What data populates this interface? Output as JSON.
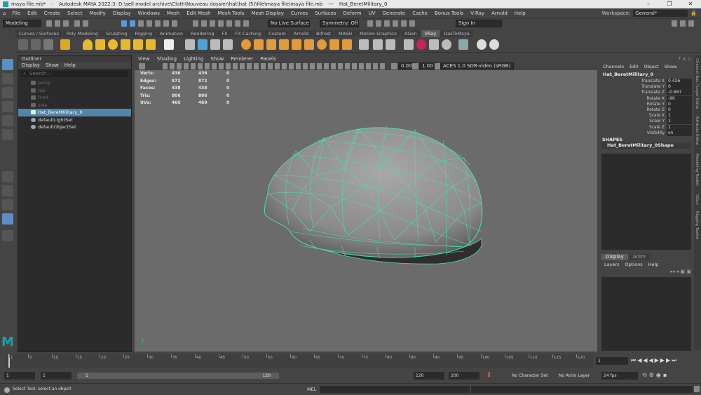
{
  "window": {
    "file": "maya file.mb*",
    "sep1": "-",
    "app": "Autodesk MAYA 2022.3: D:\\sell model archive\\Cloth\\Nouveau dossier\\hat\\hat (5)\\file\\maya file\\maya file.mb",
    "sep2": "---",
    "object": "Hat_BeretMilitary_0",
    "controls": [
      "–",
      "❐",
      "✕"
    ]
  },
  "menubar": {
    "items": [
      "File",
      "Edit",
      "Create",
      "Select",
      "Modify",
      "Display",
      "Windows",
      "Mesh",
      "Edit Mesh",
      "Mesh Tools",
      "Mesh Display",
      "Curves",
      "Surfaces",
      "Deform",
      "UV",
      "Generate",
      "Cache",
      "Bonus Tools",
      "V-Ray",
      "Arnold",
      "Help"
    ],
    "workspace_label": "Workspace:",
    "workspace_value": "General*"
  },
  "statusline": {
    "mode": "Modeling",
    "live_surface": "No Live Surface",
    "symmetry": "Symmetry: Off",
    "sign_in": "Sign In"
  },
  "shelf": {
    "tabs": [
      "Curves / Surfaces",
      "Poly Modeling",
      "Sculpting",
      "Rigging",
      "Animation",
      "Rendering",
      "FX",
      "FX Caching",
      "Custom",
      "Arnold",
      "Bifrost",
      "MASH",
      "Motion Graphics",
      "XGen",
      "VRay",
      "DasToMaya"
    ],
    "active_tab": "VRay"
  },
  "outliner": {
    "title": "Outliner",
    "menu": [
      "Display",
      "Show",
      "Help"
    ],
    "search_placeholder": "Search...",
    "items": [
      {
        "label": "persp",
        "state": "dim"
      },
      {
        "label": "top",
        "state": "dim"
      },
      {
        "label": "front",
        "state": "dim"
      },
      {
        "label": "side",
        "state": "dim"
      },
      {
        "label": "Hat_BeretMilitary_0",
        "state": "selected"
      },
      {
        "label": "defaultLightSet",
        "state": "normal"
      },
      {
        "label": "defaultObjectSet",
        "state": "normal"
      }
    ]
  },
  "viewport": {
    "menu": [
      "View",
      "Shading",
      "Lighting",
      "Show",
      "Renderer",
      "Panels"
    ],
    "toolbar": {
      "exposure": "0.00",
      "gamma": "1.00",
      "color_space": "ACES 1.0 SDR-video (sRGB)"
    },
    "hud": [
      {
        "label": "Verts:",
        "v1": "436",
        "v2": "436",
        "v3": "0"
      },
      {
        "label": "Edges:",
        "v1": "872",
        "v2": "872",
        "v3": "0"
      },
      {
        "label": "Faces:",
        "v1": "438",
        "v2": "438",
        "v3": "0"
      },
      {
        "label": "Tris:",
        "v1": "806",
        "v2": "806",
        "v3": "0"
      },
      {
        "label": "UVs:",
        "v1": "460",
        "v2": "460",
        "v3": "0"
      }
    ]
  },
  "channelbox": {
    "menu": [
      "Channels",
      "Edit",
      "Object",
      "Show"
    ],
    "object": "Hat_BeretMilitary_0",
    "channels": [
      {
        "label": "Translate X",
        "value": "0.426"
      },
      {
        "label": "Translate Y",
        "value": "0"
      },
      {
        "label": "Translate Z",
        "value": "-0.667"
      },
      {
        "label": "Rotate X",
        "value": "-90"
      },
      {
        "label": "Rotate Y",
        "value": "0"
      },
      {
        "label": "Rotate Z",
        "value": "0"
      },
      {
        "label": "Scale X",
        "value": "1"
      },
      {
        "label": "Scale Y",
        "value": "1"
      },
      {
        "label": "Scale Z",
        "value": "1"
      },
      {
        "label": "Visibility",
        "value": "on"
      }
    ],
    "shapes_header": "SHAPES",
    "shape_name": "Hat_BeretMilitary_0Shape"
  },
  "layers": {
    "tabs": [
      "Display",
      "Anim"
    ],
    "menu": [
      "Layers",
      "Options",
      "Help"
    ]
  },
  "sidebar_tabs": [
    "Channel Box / Layer Editor",
    "Attribute Editor",
    "Modelling Toolkit",
    "XGen",
    "Rigging Toolkit"
  ],
  "timeslider": {
    "ticks": [
      "1",
      "5",
      "10",
      "15",
      "20",
      "25",
      "30",
      "35",
      "40",
      "45",
      "50",
      "55",
      "60",
      "65",
      "70",
      "75",
      "80",
      "85",
      "90",
      "95",
      "100",
      "105",
      "110",
      "115",
      "120"
    ],
    "current_frame": "1"
  },
  "range": {
    "start": "1",
    "anim_start": "1",
    "range_start": "1",
    "range_end": "120",
    "end": "120",
    "anim_end": "200",
    "character_set": "No Character Set",
    "anim_layer": "No Anim Layer",
    "fps": "24 fps"
  },
  "cmdline": {
    "help": "Select Tool: select an object",
    "lang": "MEL"
  }
}
